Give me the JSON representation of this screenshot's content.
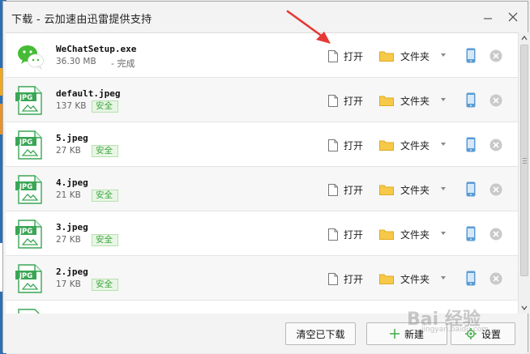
{
  "window": {
    "title": "下载 - 云加速由迅雷提供支持"
  },
  "actions": {
    "open_label": "打开",
    "folder_label": "文件夹"
  },
  "files": [
    {
      "name": "WeChatSetup.exe",
      "size": "36.30 MB",
      "status": "- 完成",
      "icon": "wechat-icon"
    },
    {
      "name": "default.jpeg",
      "size": "137 KB",
      "badge": "安全",
      "icon": "jpg-file-icon"
    },
    {
      "name": "5.jpeg",
      "size": "27 KB",
      "badge": "安全",
      "icon": "jpg-file-icon"
    },
    {
      "name": "4.jpeg",
      "size": "21 KB",
      "badge": "安全",
      "icon": "jpg-file-icon"
    },
    {
      "name": "3.jpeg",
      "size": "27 KB",
      "badge": "安全",
      "icon": "jpg-file-icon"
    },
    {
      "name": "2.jpeg",
      "size": "17 KB",
      "badge": "安全",
      "icon": "jpg-file-icon"
    }
  ],
  "jpg_label": "JPG",
  "footer": {
    "clear_label": "清空已下载",
    "new_label": "新建",
    "settings_label": "设置"
  },
  "watermark": {
    "text": "Bai 经验",
    "sub": "jingyan.baidu.com"
  },
  "colors": {
    "accent_green": "#4caf50",
    "folder_yellow": "#f7c948",
    "annotation_red": "#e53935"
  }
}
